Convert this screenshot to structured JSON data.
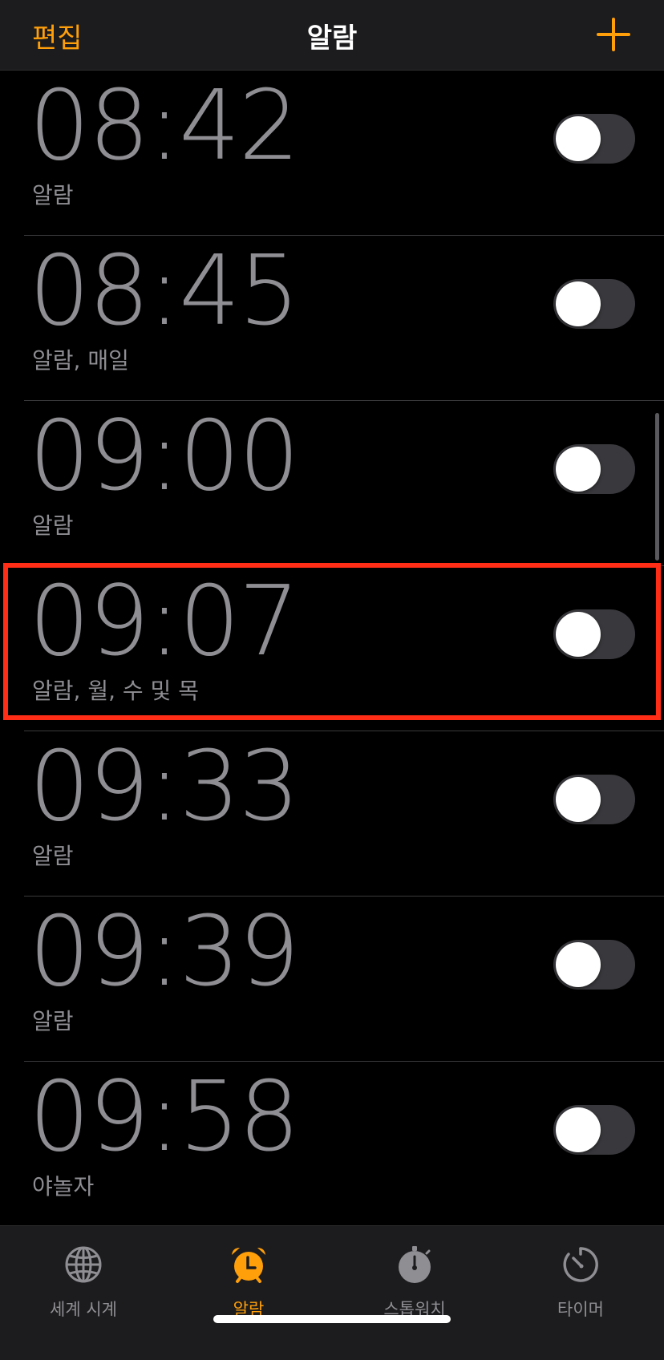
{
  "navbar": {
    "edit_label": "편집",
    "title": "알람",
    "add_icon": "plus-icon"
  },
  "alarms": [
    {
      "time": "08:42",
      "label": "알람",
      "enabled": false
    },
    {
      "time": "08:45",
      "label": "알람, 매일",
      "enabled": false
    },
    {
      "time": "09:00",
      "label": "알람",
      "enabled": false
    },
    {
      "time": "09:07",
      "label": "알람, 월, 수 및 목",
      "enabled": false,
      "highlighted": true
    },
    {
      "time": "09:33",
      "label": "알람",
      "enabled": false
    },
    {
      "time": "09:39",
      "label": "알람",
      "enabled": false
    },
    {
      "time": "09:58",
      "label": "야놀자",
      "enabled": false
    }
  ],
  "tabbar": {
    "tabs": [
      {
        "label": "세계 시계",
        "icon": "globe-icon",
        "active": false
      },
      {
        "label": "알람",
        "icon": "alarm-clock-icon",
        "active": true
      },
      {
        "label": "스톱워치",
        "icon": "stopwatch-icon",
        "active": false
      },
      {
        "label": "타이머",
        "icon": "timer-icon",
        "active": false
      }
    ]
  },
  "colors": {
    "accent": "#ff9f0a",
    "highlight": "#ff2d16",
    "inactive_text": "#8e8e93"
  }
}
